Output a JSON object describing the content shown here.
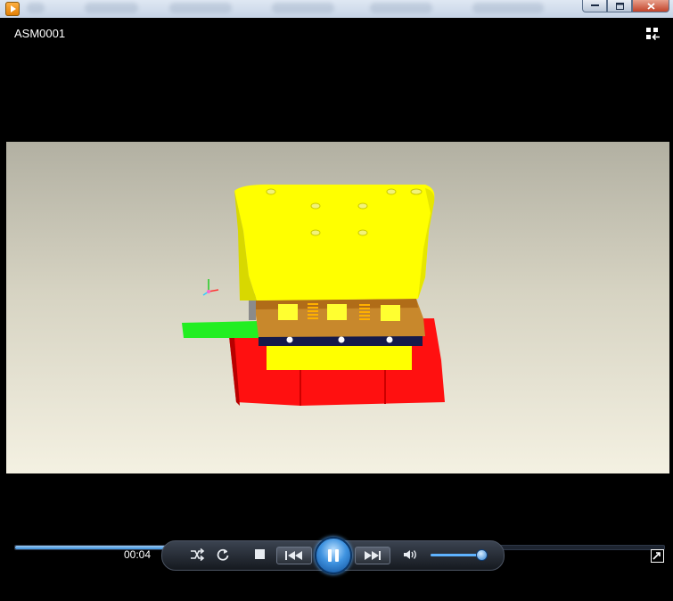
{
  "window": {
    "controls": {
      "minimize_icon": "minimize-icon",
      "maximize_icon": "maximize-icon",
      "close_icon": "close-icon"
    }
  },
  "player": {
    "video_title": "ASM0001",
    "current_time": "00:04",
    "seek_progress": 0.345,
    "volume_level": 0.9,
    "state": "playing"
  },
  "controls": {
    "shuffle_icon": "shuffle-icon",
    "repeat_icon": "repeat-icon",
    "stop_icon": "stop-icon",
    "previous_icon": "previous-icon",
    "pause_icon": "pause-icon",
    "next_icon": "next-icon",
    "volume_icon": "volume-icon",
    "fullscreen_icon": "fullscreen-icon",
    "switch_library_icon": "switch-to-library-icon"
  },
  "colors": {
    "accent": "#3a8fdc",
    "part_yellow": "#ffff00",
    "part_red": "#ff0000",
    "part_orange": "#c88a2a",
    "part_green": "#19e619"
  }
}
